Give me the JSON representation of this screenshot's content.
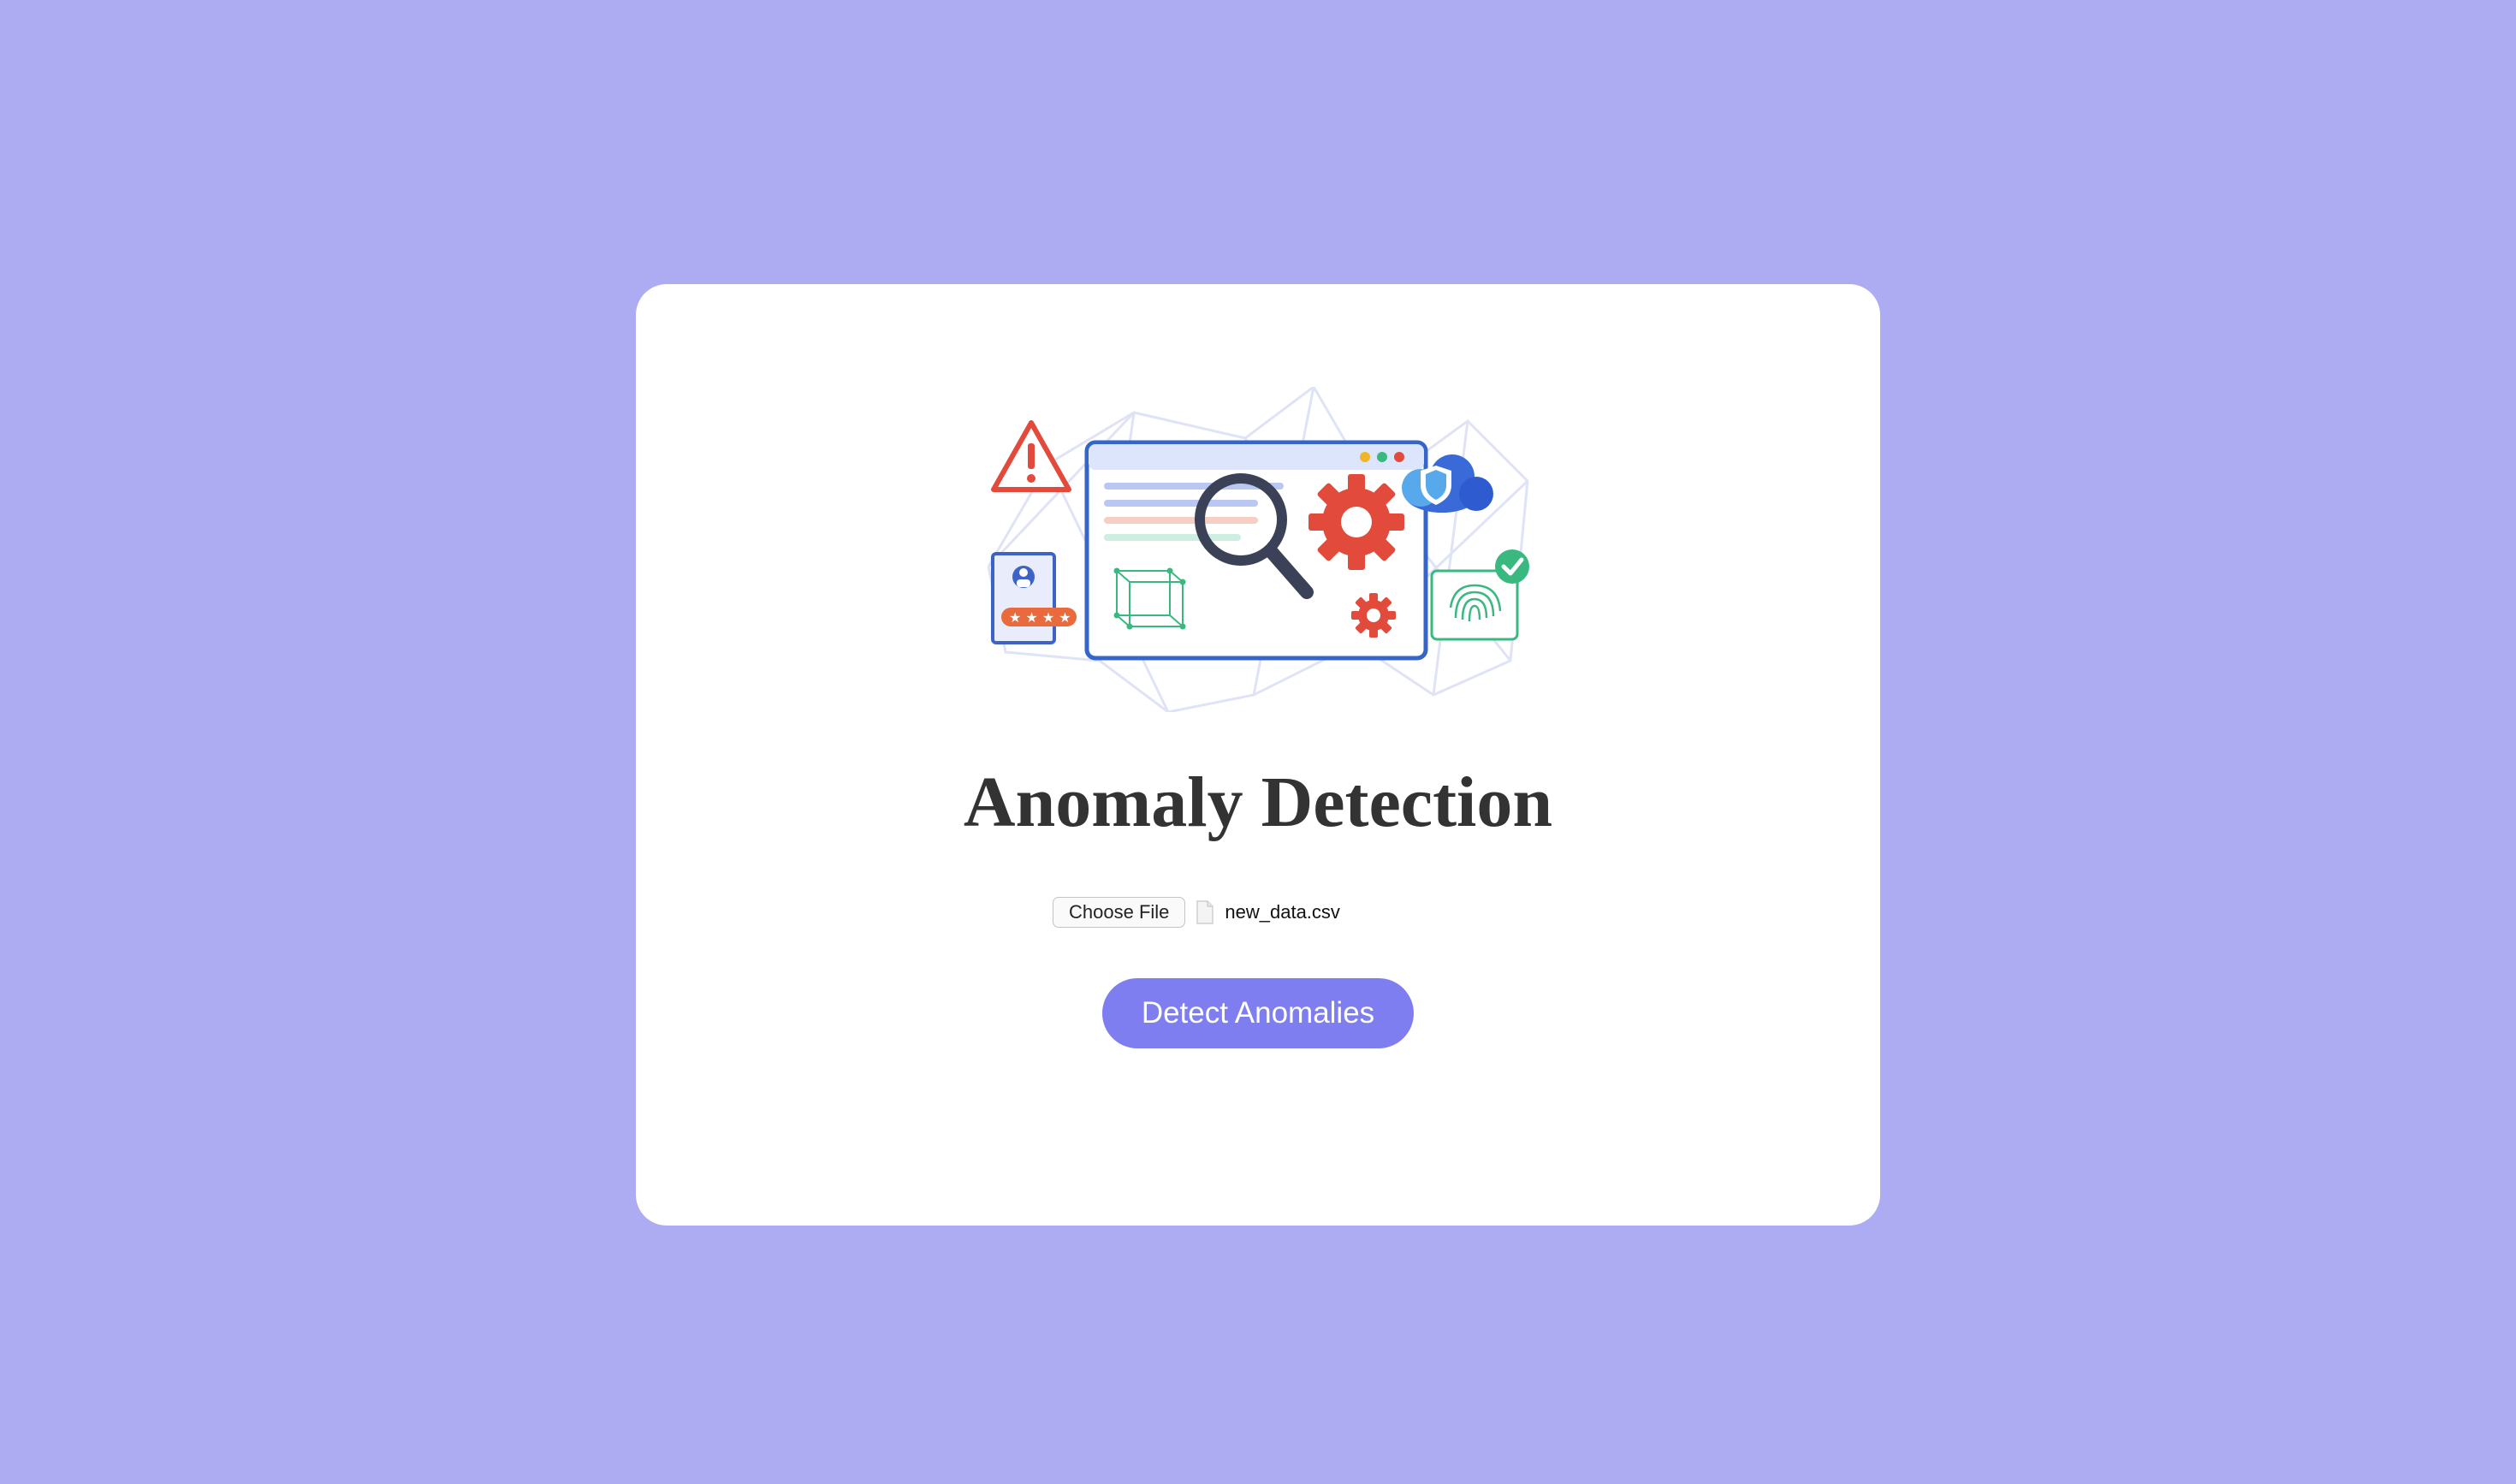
{
  "page": {
    "title": "Anomaly Detection"
  },
  "file_input": {
    "button_label": "Choose File",
    "selected_file": "new_data.csv"
  },
  "actions": {
    "detect_label": "Detect Anomalies"
  },
  "colors": {
    "background": "#adabf1",
    "card": "#ffffff",
    "accent_button": "#7f7ef0",
    "title_text": "#333333"
  },
  "icons": {
    "illustration": "anomaly-detection-illustration",
    "file": "file-icon"
  }
}
